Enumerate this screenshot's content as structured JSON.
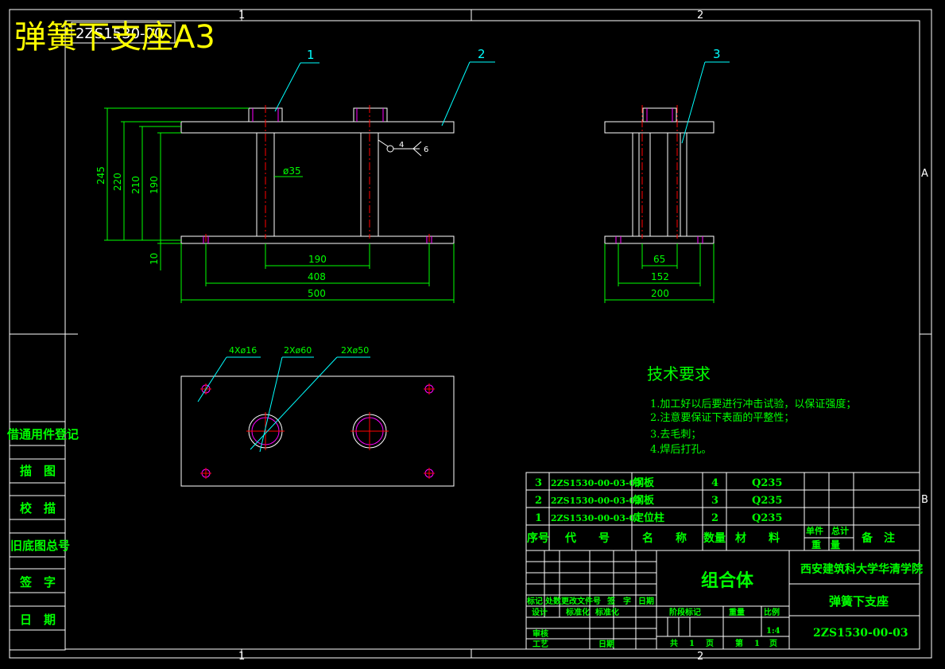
{
  "title": "弹簧下支座A3",
  "title_ghost": "2ZS1530-00",
  "zones": {
    "top_1": "1",
    "top_2": "2",
    "bottom_1": "1",
    "bottom_2": "2",
    "right_a": "A",
    "right_b": "B"
  },
  "balloons": [
    "1",
    "2",
    "3"
  ],
  "dimensions": {
    "h245": "245",
    "h220": "220",
    "h210": "210",
    "h190": "190",
    "h10": "10",
    "dia35": "ø35",
    "w190": "190",
    "w408": "408",
    "w500": "500",
    "w65": "65",
    "w152": "152",
    "w200": "200",
    "holes16": "4Xø16",
    "holes60": "2Xø60",
    "holes50": "2Xø50",
    "weld_4": "4",
    "weld_6": "6"
  },
  "left_column": [
    "借通用件登记",
    "描　图",
    "校　描",
    "旧底图总号",
    "签　字",
    "日　期"
  ],
  "tech_requirements": {
    "heading": "技术要求",
    "items": [
      "1.加工好以后要进行冲击试验，以保证强度；",
      "2.注意要保证下表面的平整性；",
      "3.去毛刺；",
      "4.焊后打孔。"
    ]
  },
  "parts_list": {
    "rows": [
      {
        "no": "3",
        "code": "2ZS1530-00-03-03",
        "name": "钢板",
        "qty": "4",
        "material": "Q235"
      },
      {
        "no": "2",
        "code": "2ZS1530-00-03-02",
        "name": "钢板",
        "qty": "3",
        "material": "Q235"
      },
      {
        "no": "1",
        "code": "2ZS1530-00-03-01",
        "name": "定位柱",
        "qty": "2",
        "material": "Q235"
      }
    ],
    "headers": {
      "no": "序号",
      "code": "代　　号",
      "name": "名　　称",
      "qty": "数量",
      "material": "材　　料",
      "unit_weight": "单件",
      "total_weight": "总计",
      "weight": "重　量",
      "note": "备　注"
    }
  },
  "title_block": {
    "assembly": "组合体",
    "school": "西安建筑科大学华清学院",
    "drawing_name": "弹簧下支座",
    "drawing_no": "2ZS1530-00-03",
    "scale": "1:4",
    "rev_labels": [
      "标记",
      "处数",
      "更改文件号",
      "签　字",
      "日期"
    ],
    "design": "设计",
    "standard": "标准化",
    "std_check": "标准化",
    "review": "审核",
    "process": "工艺",
    "date": "日期",
    "stage": "阶段标记",
    "weight_label": "重量",
    "scale_label": "比例",
    "total": "共",
    "sheet": "页",
    "sheet_no": "第",
    "one": "1"
  },
  "colors": {
    "frame": "#ffffff",
    "text": "#00ff00",
    "dim": "#00ff00",
    "leader": "#00ffff",
    "center": "#ff0000",
    "hidden": "#ff00ff",
    "title": "#ffff00"
  }
}
